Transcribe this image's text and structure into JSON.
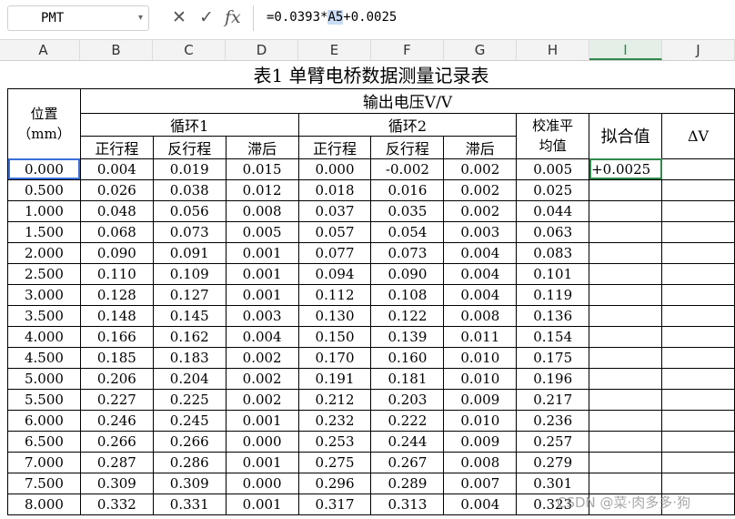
{
  "formula_bar": {
    "name_box": "PMT",
    "formula_prefix": "=0.0393*",
    "formula_ref": "A5",
    "formula_suffix": "+0.0025"
  },
  "columns": [
    "A",
    "B",
    "C",
    "D",
    "E",
    "F",
    "G",
    "H",
    "I",
    "J"
  ],
  "table": {
    "title": "表1  单臂电桥数据测量记录表",
    "position_label": "位置",
    "position_unit": "（mm）",
    "output_voltage": "输出电压V/V",
    "cycle1": "循环1",
    "cycle2": "循环2",
    "calib_avg": "校准平均值",
    "fit_value": "拟合值",
    "delta_v": "ΔV",
    "subheaders": [
      "正行程",
      "反行程",
      "滞后",
      "正行程",
      "反行程",
      "滞后"
    ],
    "rows": [
      [
        "0.000",
        "0.004",
        "0.019",
        "0.015",
        "0.000",
        "-0.002",
        "0.002",
        "0.005"
      ],
      [
        "0.500",
        "0.026",
        "0.038",
        "0.012",
        "0.018",
        "0.016",
        "0.002",
        "0.025"
      ],
      [
        "1.000",
        "0.048",
        "0.056",
        "0.008",
        "0.037",
        "0.035",
        "0.002",
        "0.044"
      ],
      [
        "1.500",
        "0.068",
        "0.073",
        "0.005",
        "0.057",
        "0.054",
        "0.003",
        "0.063"
      ],
      [
        "2.000",
        "0.090",
        "0.091",
        "0.001",
        "0.077",
        "0.073",
        "0.004",
        "0.083"
      ],
      [
        "2.500",
        "0.110",
        "0.109",
        "0.001",
        "0.094",
        "0.090",
        "0.004",
        "0.101"
      ],
      [
        "3.000",
        "0.128",
        "0.127",
        "0.001",
        "0.112",
        "0.108",
        "0.004",
        "0.119"
      ],
      [
        "3.500",
        "0.148",
        "0.145",
        "0.003",
        "0.130",
        "0.122",
        "0.008",
        "0.136"
      ],
      [
        "4.000",
        "0.166",
        "0.162",
        "0.004",
        "0.150",
        "0.139",
        "0.011",
        "0.154"
      ],
      [
        "4.500",
        "0.185",
        "0.183",
        "0.002",
        "0.170",
        "0.160",
        "0.010",
        "0.175"
      ],
      [
        "5.000",
        "0.206",
        "0.204",
        "0.002",
        "0.191",
        "0.181",
        "0.010",
        "0.196"
      ],
      [
        "5.500",
        "0.227",
        "0.225",
        "0.002",
        "0.212",
        "0.203",
        "0.009",
        "0.217"
      ],
      [
        "6.000",
        "0.246",
        "0.245",
        "0.001",
        "0.232",
        "0.222",
        "0.010",
        "0.236"
      ],
      [
        "6.500",
        "0.266",
        "0.266",
        "0.000",
        "0.253",
        "0.244",
        "0.009",
        "0.257"
      ],
      [
        "7.000",
        "0.287",
        "0.286",
        "0.001",
        "0.275",
        "0.267",
        "0.008",
        "0.279"
      ],
      [
        "7.500",
        "0.309",
        "0.309",
        "0.000",
        "0.296",
        "0.289",
        "0.007",
        "0.301"
      ],
      [
        "8.000",
        "0.332",
        "0.331",
        "0.001",
        "0.317",
        "0.313",
        "0.004",
        "0.323"
      ]
    ],
    "editing_cell": "+0.0025"
  },
  "watermark": "CSDN @菜·肉多多·狗"
}
